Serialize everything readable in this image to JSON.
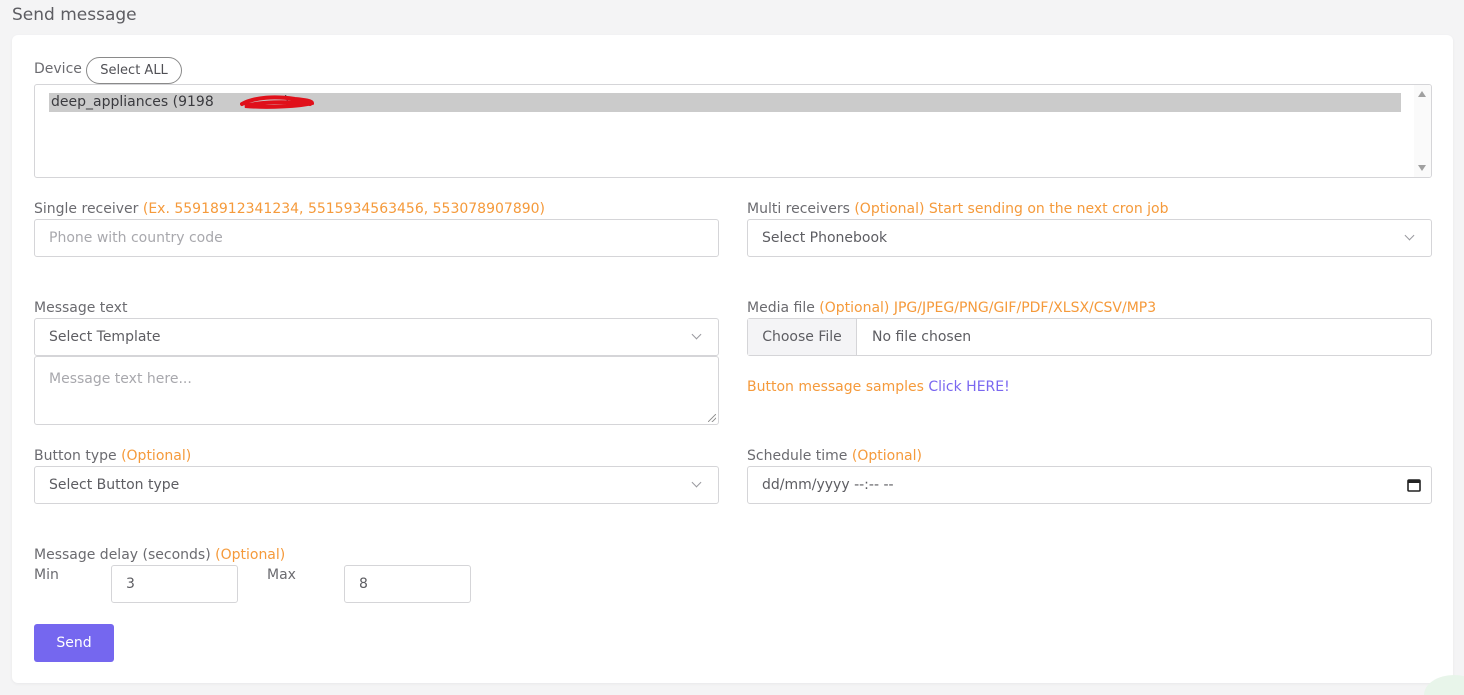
{
  "page": {
    "title": "Send message"
  },
  "device": {
    "label": "Device",
    "select_all": "Select ALL",
    "options": [
      "deep_appliances (9198"
    ],
    "option_suffix": ")"
  },
  "single_receiver": {
    "label": "Single receiver",
    "hint": "(Ex. 55918912341234, 5515934563456, 553078907890)",
    "placeholder": "Phone with country code"
  },
  "multi_receivers": {
    "label": "Multi receivers",
    "hint": "(Optional) Start sending on the next cron job",
    "selected": "Select Phonebook"
  },
  "message_text": {
    "label": "Message text",
    "template_selected": "Select Template",
    "placeholder": "Message text here..."
  },
  "media_file": {
    "label": "Media file",
    "hint": "(Optional) JPG/JPEG/PNG/GIF/PDF/XLSX/CSV/MP3",
    "choose_label": "Choose File",
    "file_name": "No file chosen"
  },
  "button_samples": {
    "text": "Button message samples",
    "link": "Click HERE!"
  },
  "button_type": {
    "label": "Button type",
    "hint": "(Optional)",
    "selected": "Select Button type"
  },
  "schedule_time": {
    "label": "Schedule time",
    "hint": "(Optional)",
    "value": "dd/mm/yyyy --:-- --"
  },
  "message_delay": {
    "label": "Message delay (seconds)",
    "hint": "(Optional)",
    "min_label": "Min",
    "min_value": "3",
    "max_label": "Max",
    "max_value": "8"
  },
  "actions": {
    "send": "Send"
  },
  "colors": {
    "accent": "#7567ef",
    "hint": "#f59a3b",
    "link": "#7a67f0"
  }
}
